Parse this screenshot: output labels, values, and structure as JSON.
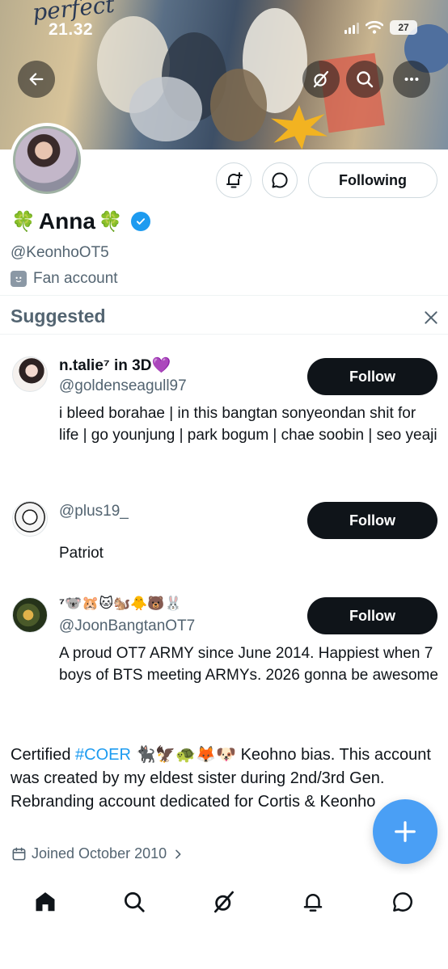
{
  "status_bar": {
    "time": "21.32",
    "battery": "27"
  },
  "banner": {
    "logo_text": "perfect"
  },
  "profile": {
    "display_name": "Anna",
    "handle": "@KeonhoOT5",
    "label": "Fan account",
    "following_label": "Following"
  },
  "suggested": {
    "title": "Suggested",
    "follow_label": "Follow",
    "users": [
      {
        "name": "n.talie⁷ in 3D💜",
        "handle": "@goldenseagull97",
        "bio": "i bleed borahae | in this bangtan sonyeondan shit for life | go younjung | park bogum | chae soobin | seo yeaji"
      },
      {
        "name": "",
        "handle": "@plus19_",
        "bio": "Patriot"
      },
      {
        "name": "⁷🐨🐹🐱🐿️🐥🐻🐰",
        "handle": "@JoonBangtanOT7",
        "bio": "A proud OT7 ARMY since June 2014. Happiest when 7 boys of BTS meeting ARMYs. 2026 gonna be awesome"
      }
    ]
  },
  "bio": {
    "before": "Certified ",
    "hashtag": "#COER",
    "emojis": " 🐈‍⬛🦅🐢🦊🐶",
    "after": " Keohno bias. This account was created by my eldest sister during 2nd/3rd Gen. Rebranding account dedicated for Cortis & Keonho"
  },
  "joined": "Joined October 2010",
  "colors": {
    "accent": "#1d9bf0",
    "fab": "#4a9ff5",
    "text": "#0f1419",
    "muted": "#536471"
  },
  "icons": {
    "back": "arrow-left-icon",
    "grok": "grok-icon",
    "search": "search-icon",
    "more": "more-icon",
    "notify": "bell-plus-icon",
    "message": "message-icon",
    "close": "close-icon",
    "calendar": "calendar-icon",
    "compose": "plus-icon",
    "nav": [
      "home-icon",
      "search-icon",
      "grok-icon",
      "bell-icon",
      "message-icon"
    ]
  }
}
